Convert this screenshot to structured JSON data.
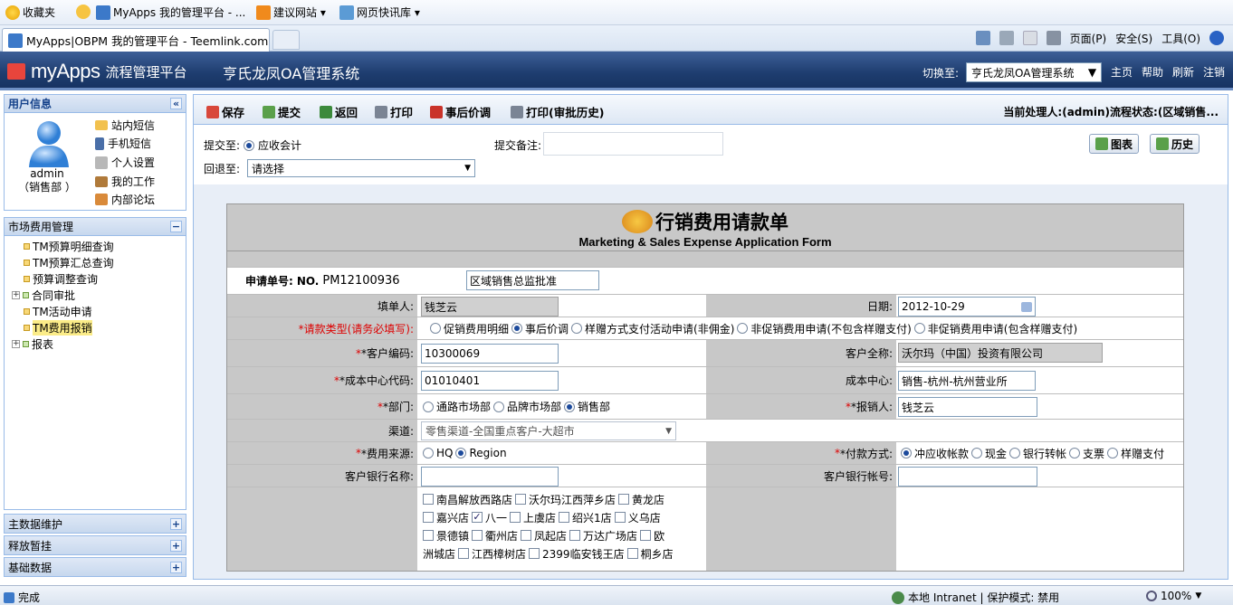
{
  "browser": {
    "favorites_label": "收藏夹",
    "fav_items": [
      "MyApps 我的管理平台 - ...",
      "建议网站 ▾",
      "网页快讯库 ▾"
    ],
    "tab_title": "MyApps|OBPM 我的管理平台 - Teemlink.com",
    "tools": {
      "page": "页面(P)",
      "safety": "安全(S)",
      "tools": "工具(O)"
    }
  },
  "app": {
    "logo": "myApps",
    "logo_text": "流程管理平台",
    "system_title": "亨氏龙凤OA管理系统",
    "switch_label": "切换至:",
    "switch_value": "亨氏龙凤OA管理系统",
    "links": [
      "主页",
      "帮助",
      "刷新",
      "注销"
    ]
  },
  "userinfo": {
    "title": "用户信息",
    "name": "admin",
    "dept": "（销售部 ）",
    "links": [
      "站内短信",
      "手机短信",
      "个人设置",
      "我的工作",
      "内部论坛"
    ]
  },
  "menu": {
    "title": "市场费用管理",
    "items": [
      "TM预算明细查询",
      "TM预算汇总查询",
      "预算调整查询",
      "合同审批",
      "TM活动申请",
      "TM费用报销",
      "报表"
    ],
    "folds": [
      "主数据维护",
      "释放暂挂",
      "基础数据"
    ]
  },
  "toolbar": {
    "save": "保存",
    "submit": "提交",
    "back": "返回",
    "print": "打印",
    "post_price": "事后价调",
    "print_history": "打印(审批历史)",
    "current": "当前处理人:(admin)流程状态:(区域销售..."
  },
  "submit": {
    "submit_to_label": "提交至:",
    "submit_to_option": "应收会计",
    "return_label": "回退至:",
    "return_value": "请选择",
    "remark_label": "提交备注:",
    "chart_btn": "图表",
    "history_btn": "历史"
  },
  "form": {
    "title": "行销费用请款单",
    "subtitle": "Marketing & Sales Expense Application Form",
    "no_label": "申请单号:",
    "no_prefix": "NO.",
    "no_value": "PM12100936",
    "stage": "区域销售总监批准",
    "filler_label": "填单人:",
    "filler": "钱芝云",
    "date_label": "日期:",
    "date": "2012-10-29",
    "type_label": "*请款类型(请务必填写):",
    "types": [
      "促销费用明细",
      "事后价调",
      "样赠方式支付活动申请(非佣金)",
      "非促销费用申请(不包含样赠支付)",
      "非促销费用申请(包含样赠支付)"
    ],
    "cust_code_label": "*客户编码:",
    "cust_code": "10300069",
    "cust_name_label": "客户全称:",
    "cust_name": "沃尔玛（中国）投资有限公司",
    "cc_code_label": "*成本中心代码:",
    "cc_code": "01010401",
    "cc_label": "成本中心:",
    "cc": "销售-杭州-杭州营业所",
    "dept_label": "*部门:",
    "depts": [
      "通路市场部",
      "品牌市场部",
      "销售部"
    ],
    "reporter_label": "*报销人:",
    "reporter": "钱芝云",
    "channel_label": "渠道:",
    "channel": "零售渠道-全国重点客户-大超市",
    "source_label": "*费用来源:",
    "sources": [
      "HQ",
      "Region"
    ],
    "pay_label": "*付款方式:",
    "pays": [
      "冲应收帐款",
      "现金",
      "银行转帐",
      "支票",
      "样赠支付"
    ],
    "bank_name_label": "客户银行名称:",
    "bank_acct_label": "客户银行帐号:",
    "stores_line1": [
      "南昌解放西路店",
      "沃尔玛江西萍乡店",
      "黄龙店"
    ],
    "stores_line2": [
      "嘉兴店",
      "八一",
      "上虞店",
      "绍兴1店",
      "义乌店"
    ],
    "stores_line3": [
      "景德镇",
      "衢州店",
      "凤起店",
      "万达广场店",
      "欧"
    ],
    "stores_line4_prefix": "洲城店",
    "stores_line4": [
      "江西樟树店",
      "2399临安钱王店",
      "桐乡店"
    ]
  },
  "status": {
    "left": "完成",
    "zone": "本地 Intranet | 保护模式: 禁用",
    "zoom": "100%"
  }
}
